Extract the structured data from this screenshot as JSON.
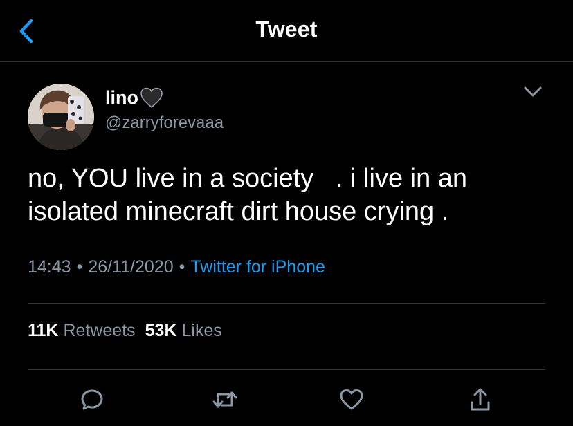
{
  "header": {
    "title": "Tweet",
    "back_icon": "chevron-left-icon"
  },
  "tweet": {
    "author": {
      "display_name": "lino",
      "name_emoji": "black-heart-icon",
      "handle": "@zarryforevaaa"
    },
    "text": "no, YOU live in a society   . i live in an\nisolated minecraft dirt house crying .",
    "time": "14:43",
    "date": "26/11/2020",
    "separator": "•",
    "source": "Twitter for iPhone",
    "stats": {
      "retweets_count": "11K",
      "retweets_label": "Retweets",
      "likes_count": "53K",
      "likes_label": "Likes"
    }
  },
  "colors": {
    "background": "#000000",
    "text": "#ffffff",
    "muted": "#8b98a5",
    "accent": "#1d9bf0",
    "divider": "#2f3336"
  },
  "actions": [
    "reply-icon",
    "retweet-icon",
    "like-icon",
    "share-icon"
  ]
}
